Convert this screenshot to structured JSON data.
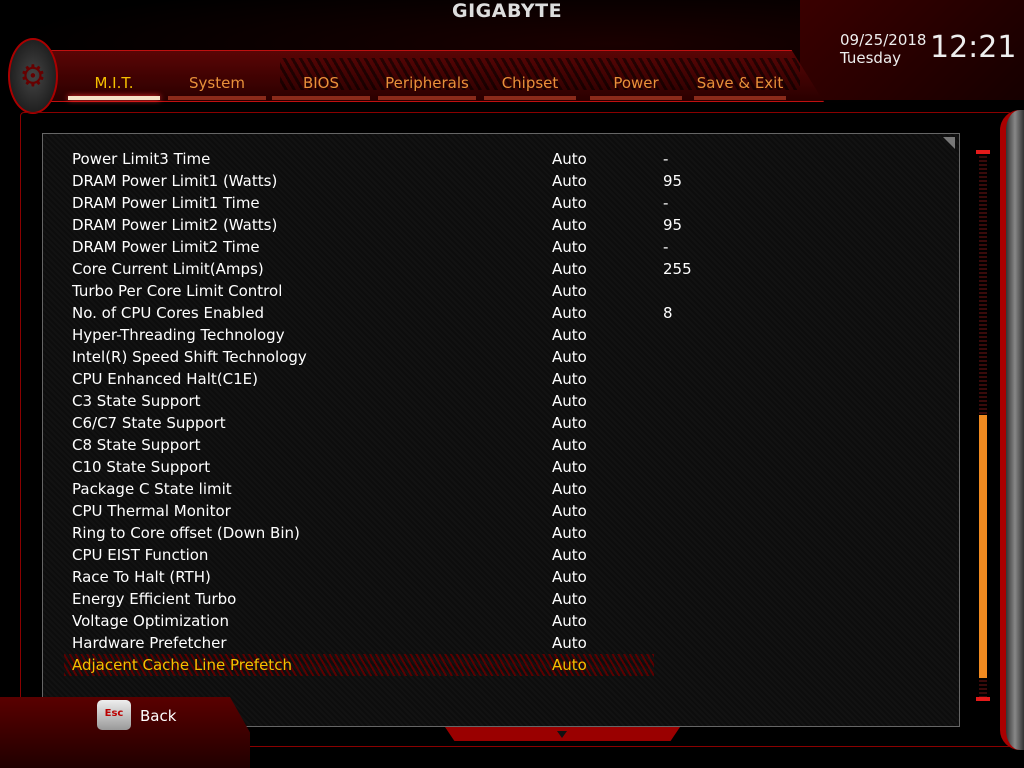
{
  "brand": "GIGABYTE",
  "tabs": [
    {
      "label": "M.I.T.",
      "active": true
    },
    {
      "label": "System"
    },
    {
      "label": "BIOS"
    },
    {
      "label": "Peripherals"
    },
    {
      "label": "Chipset"
    },
    {
      "label": "Power"
    },
    {
      "label": "Save & Exit"
    }
  ],
  "datetime": {
    "date": "09/25/2018",
    "day": "Tuesday",
    "time": "12:21"
  },
  "settings": [
    {
      "label": "Power Limit3 Time",
      "value": "Auto",
      "extra": "-"
    },
    {
      "label": "DRAM Power Limit1 (Watts)",
      "value": "Auto",
      "extra": "95"
    },
    {
      "label": "DRAM Power Limit1 Time",
      "value": "Auto",
      "extra": "-"
    },
    {
      "label": "DRAM Power Limit2 (Watts)",
      "value": "Auto",
      "extra": "95"
    },
    {
      "label": "DRAM Power Limit2 Time",
      "value": "Auto",
      "extra": "-"
    },
    {
      "label": "Core Current Limit(Amps)",
      "value": "Auto",
      "extra": "255"
    },
    {
      "label": "Turbo Per Core Limit Control",
      "value": "Auto",
      "extra": ""
    },
    {
      "label": "No. of CPU Cores Enabled",
      "value": "Auto",
      "extra": "8"
    },
    {
      "label": "Hyper-Threading Technology",
      "value": "Auto",
      "extra": ""
    },
    {
      "label": "Intel(R) Speed Shift Technology",
      "value": "Auto",
      "extra": ""
    },
    {
      "label": "CPU Enhanced Halt(C1E)",
      "value": "Auto",
      "extra": ""
    },
    {
      "label": "C3 State Support",
      "value": "Auto",
      "extra": ""
    },
    {
      "label": "C6/C7 State Support",
      "value": "Auto",
      "extra": ""
    },
    {
      "label": "C8 State Support",
      "value": "Auto",
      "extra": ""
    },
    {
      "label": "C10 State Support",
      "value": "Auto",
      "extra": ""
    },
    {
      "label": "Package C State limit",
      "value": "Auto",
      "extra": ""
    },
    {
      "label": "CPU Thermal Monitor",
      "value": "Auto",
      "extra": ""
    },
    {
      "label": "Ring to Core offset (Down Bin)",
      "value": "Auto",
      "extra": ""
    },
    {
      "label": "CPU EIST Function",
      "value": "Auto",
      "extra": ""
    },
    {
      "label": "Race To Halt (RTH)",
      "value": "Auto",
      "extra": ""
    },
    {
      "label": "Energy Efficient Turbo",
      "value": "Auto",
      "extra": ""
    },
    {
      "label": "Voltage Optimization",
      "value": "Auto",
      "extra": ""
    },
    {
      "label": "Hardware Prefetcher",
      "value": "Auto",
      "extra": ""
    },
    {
      "label": "Adjacent Cache Line Prefetch",
      "value": "Auto",
      "extra": "",
      "selected": true
    }
  ],
  "scrollbar": {
    "thumb_start": 0.48,
    "thumb_end": 0.96
  },
  "footer": {
    "esc_key": "Esc",
    "back_label": "Back"
  },
  "colors": {
    "accent": "#f5c000",
    "tab": "#e8903a",
    "scroll_thumb": "#f08a20",
    "frame": "#c01010"
  }
}
